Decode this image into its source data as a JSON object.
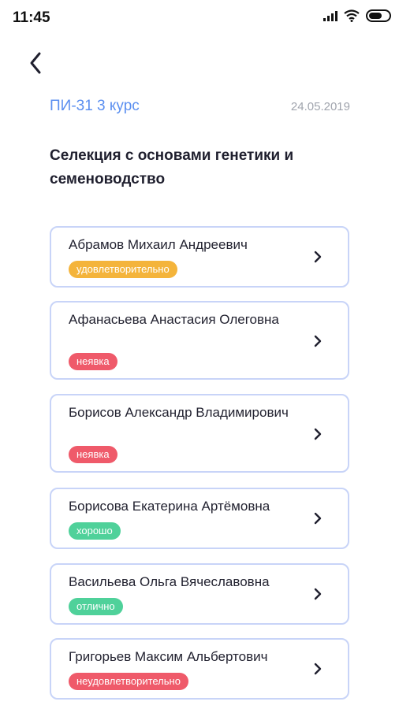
{
  "status_bar": {
    "time": "11:45"
  },
  "header": {
    "group": "ПИ-31 3 курс",
    "date": "24.05.2019"
  },
  "subject": "Селекция с основами генетики и семеноводство",
  "colors": {
    "accent": "#5b8ff0",
    "card_border": "#c8d4f8",
    "grade_satisfactory": "#f4b43b",
    "grade_absent": "#ef5a6a",
    "grade_good": "#4fd19a",
    "grade_excellent": "#4fd19a",
    "grade_unsatisfactory": "#ef5a6a"
  },
  "students": [
    {
      "name": "Абрамов Михаил Андреевич",
      "grade": "удовлетворительно",
      "color": "#f4b43b"
    },
    {
      "name": "Афанасьева Анастасия Олеговна",
      "grade": "неявка",
      "color": "#ef5a6a"
    },
    {
      "name": "Борисов Александр Владимирович",
      "grade": "неявка",
      "color": "#ef5a6a"
    },
    {
      "name": "Борисова Екатерина Артёмовна",
      "grade": "хорошо",
      "color": "#4fd19a"
    },
    {
      "name": "Васильева Ольга Вячеславовна",
      "grade": "отлично",
      "color": "#4fd19a"
    },
    {
      "name": "Григорьев Максим Альбертович",
      "grade": "неудовлетворительно",
      "color": "#ef5a6a"
    }
  ]
}
